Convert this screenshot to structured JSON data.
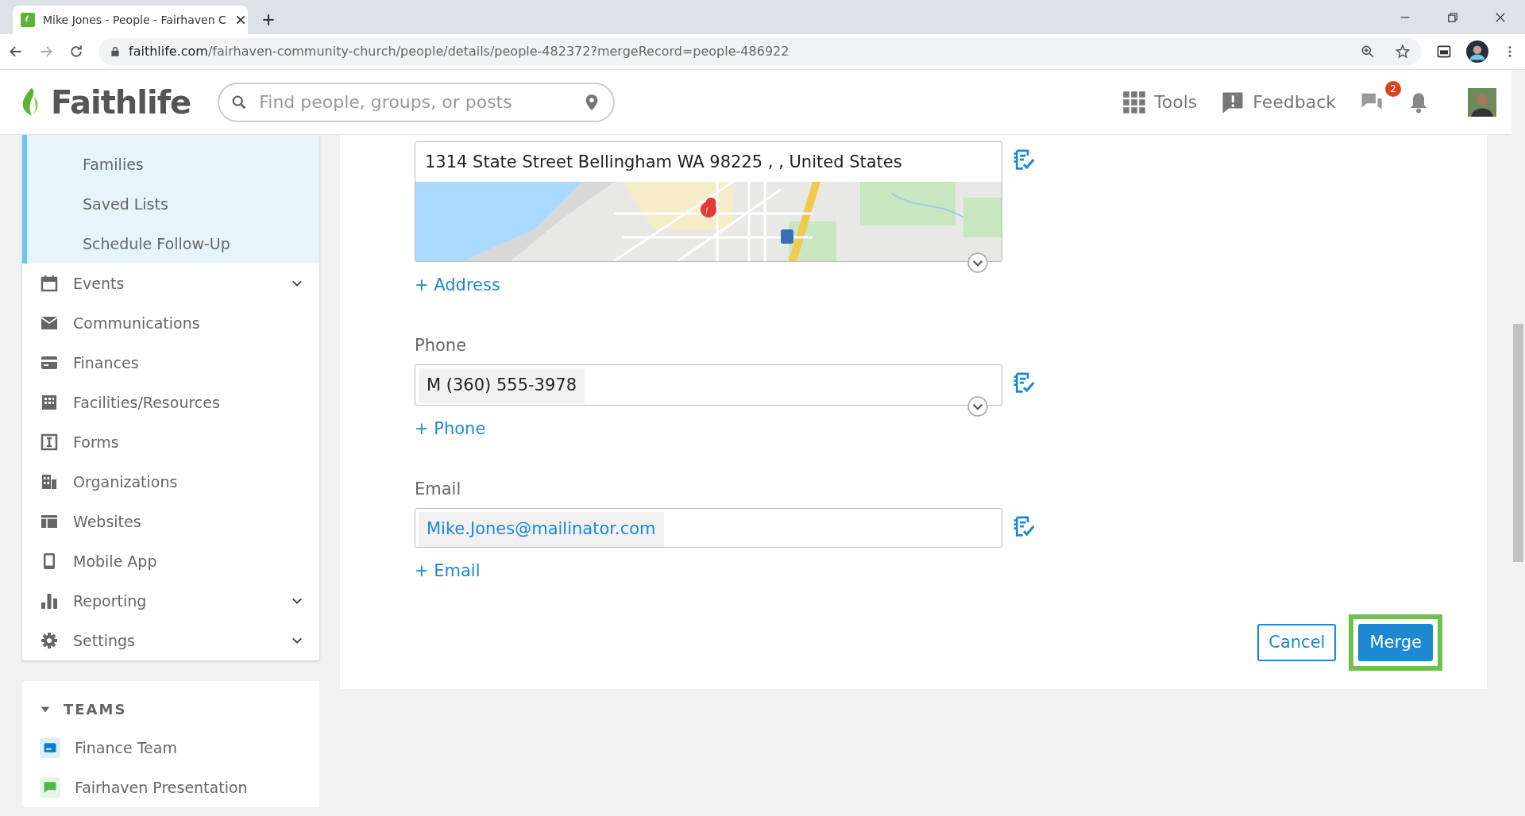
{
  "browser": {
    "tab_title": "Mike Jones - People - Fairhaven C",
    "url_host": "faithlife.com",
    "url_path": "/fairhaven-community-church/people/details/people-482372?mergeRecord=people-486922"
  },
  "header": {
    "logo": "Faithlife",
    "search": {
      "placeholder": "Find people, groups, or posts"
    },
    "tools": "Tools",
    "feedback": "Feedback",
    "messages_badge": "2"
  },
  "sidebar": {
    "items": [
      {
        "label": "Families",
        "kind": "sub"
      },
      {
        "label": "Saved Lists",
        "kind": "sub"
      },
      {
        "label": "Schedule Follow-Up",
        "kind": "sub"
      },
      {
        "label": "Events",
        "kind": "main",
        "expandable": true
      },
      {
        "label": "Communications",
        "kind": "main",
        "expandable": false
      },
      {
        "label": "Finances",
        "kind": "main",
        "expandable": false
      },
      {
        "label": "Facilities/Resources",
        "kind": "main",
        "expandable": false
      },
      {
        "label": "Forms",
        "kind": "main",
        "expandable": false
      },
      {
        "label": "Organizations",
        "kind": "main",
        "expandable": false
      },
      {
        "label": "Websites",
        "kind": "main",
        "expandable": false
      },
      {
        "label": "Mobile App",
        "kind": "main",
        "expandable": false
      },
      {
        "label": "Reporting",
        "kind": "main",
        "expandable": true
      },
      {
        "label": "Settings",
        "kind": "main",
        "expandable": true
      }
    ]
  },
  "teams": {
    "title": "TEAMS",
    "expanded": true,
    "items": [
      {
        "label": "Finance Team",
        "color": "#0b7fcf"
      },
      {
        "label": "Fairhaven Presentation",
        "color": "#4fb848"
      }
    ]
  },
  "form": {
    "address": {
      "value": "1314 State Street Bellingham WA 98225 ,   , United States",
      "add_link": "+ Address"
    },
    "phone": {
      "label": "Phone",
      "value": "M (360) 555-3978",
      "add_link": "+ Phone"
    },
    "email": {
      "label": "Email",
      "value": "Mike.Jones@mailinator.com",
      "add_link": "+ Email"
    },
    "buttons": [
      {
        "label": "Cancel",
        "kind": "secondary",
        "highlighted": false
      },
      {
        "label": "Merge",
        "kind": "primary",
        "highlighted": true
      }
    ]
  }
}
